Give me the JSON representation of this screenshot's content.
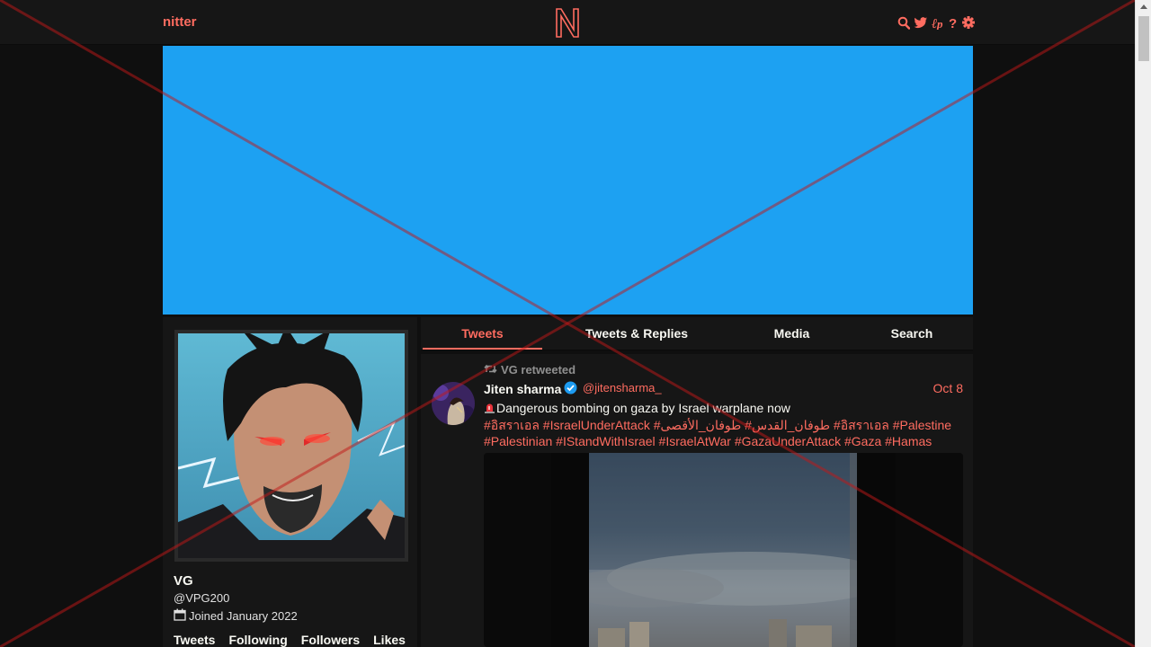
{
  "nav": {
    "brand": "nitter",
    "logo_letter": "N",
    "icons": [
      "search-icon",
      "twitter-icon",
      "rss-icon",
      "help-icon",
      "gear-icon"
    ]
  },
  "colors": {
    "accent": "#ff6c60",
    "banner": "#1da1f2",
    "background": "#0f0f0f",
    "panel": "#161616"
  },
  "profile": {
    "name": "VG",
    "handle": "@VPG200",
    "joined": "Joined January 2022",
    "stats": [
      "Tweets",
      "Following",
      "Followers",
      "Likes"
    ]
  },
  "tabs": [
    {
      "label": "Tweets",
      "active": true
    },
    {
      "label": "Tweets & Replies",
      "active": false
    },
    {
      "label": "Media",
      "active": false
    },
    {
      "label": "Search",
      "active": false
    }
  ],
  "tweet": {
    "retweet_label": "VG retweeted",
    "author_name": "Jiten sharma",
    "author_handle": "@jitensharma_",
    "date": "Oct 8",
    "text": "Dangerous bombing on gaza by Israel warplane now",
    "hashtags_line1": "#อิสราเอล #IsraelUnderAttack #طوفان_القدس# طوفان_الأقصى #อิสราเอล #Palestine",
    "hashtags_line2": "#Palestinian #IStandWithIsrael #IsraelAtWar #GazaUnderAttack #Gaza #Hamas"
  }
}
